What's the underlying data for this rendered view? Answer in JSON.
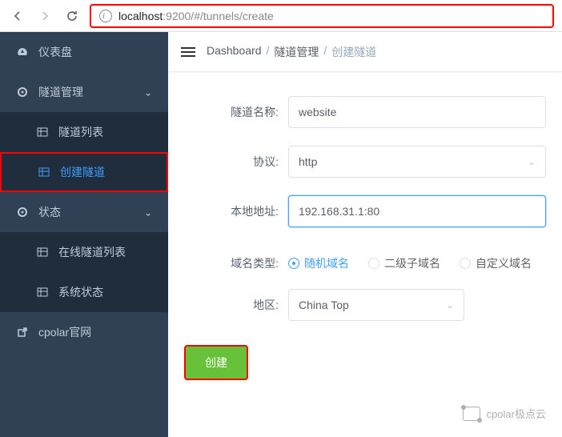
{
  "browser": {
    "url_prefix": "localhost",
    "url_suffix": ":9200/#/tunnels/create"
  },
  "sidebar": {
    "dashboard": "仪表盘",
    "tunnel_mgmt": "隧道管理",
    "tunnel_list": "隧道列表",
    "create_tunnel": "创建隧道",
    "status": "状态",
    "online_list": "在线隧道列表",
    "sys_status": "系统状态",
    "official": "cpolar官网"
  },
  "breadcrumb": {
    "a": "Dashboard",
    "b": "隧道管理",
    "c": "创建隧道"
  },
  "form": {
    "name_label": "隧道名称:",
    "name_value": "website",
    "proto_label": "协议:",
    "proto_value": "http",
    "addr_label": "本地地址:",
    "addr_value": "192.168.31.1:80",
    "domain_label": "域名类型:",
    "domain_opts": {
      "rand": "随机域名",
      "sub": "二级子域名",
      "custom": "自定义域名"
    },
    "region_label": "地区:",
    "region_value": "China Top",
    "submit": "创建"
  },
  "watermark": "cpolar极点云"
}
